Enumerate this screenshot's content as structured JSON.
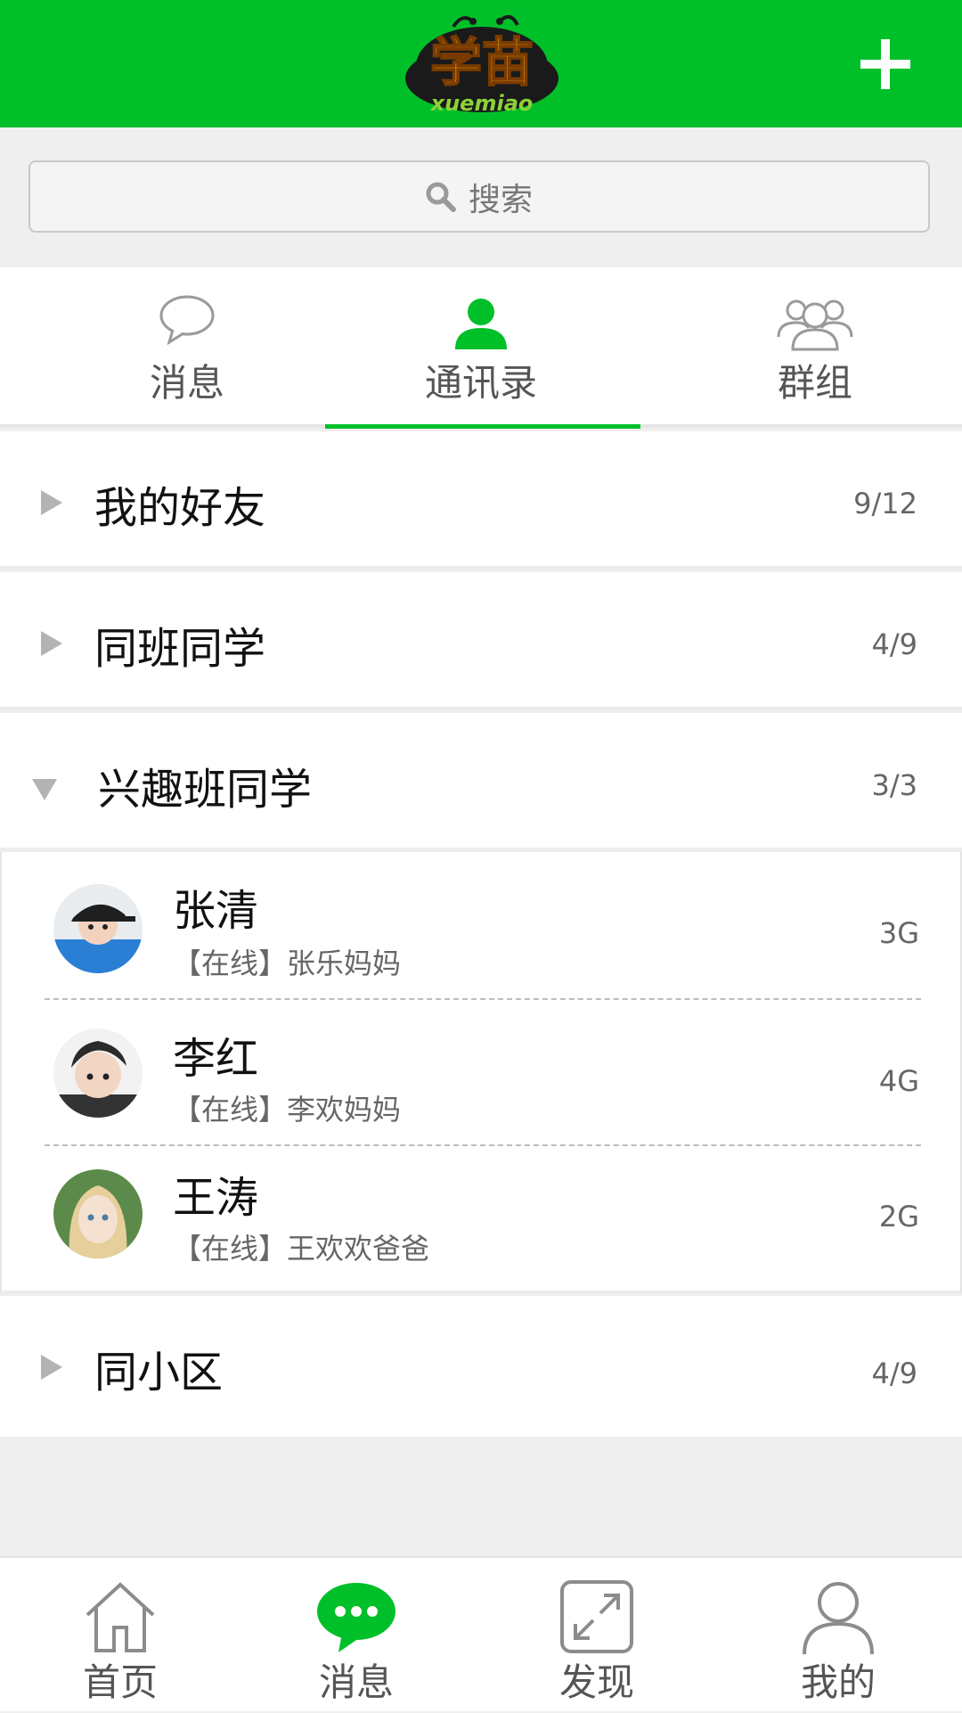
{
  "header": {
    "logo_text": "学苗",
    "logo_subtext": "xuemiao",
    "add_icon": "plus-icon",
    "brand_color": "#00c029"
  },
  "search": {
    "placeholder": "搜索",
    "icon": "search-icon"
  },
  "tabs": [
    {
      "label": "消息",
      "icon": "chat-bubble-icon",
      "active": false
    },
    {
      "label": "通讯录",
      "icon": "contact-person-icon",
      "active": true
    },
    {
      "label": "群组",
      "icon": "group-people-icon",
      "active": false
    }
  ],
  "groups": [
    {
      "name": "我的好友",
      "count": "9/12",
      "expanded": false
    },
    {
      "name": "同班同学",
      "count": "4/9",
      "expanded": false
    },
    {
      "name": "兴趣班同学",
      "count": "3/3",
      "expanded": true
    },
    {
      "name": "同小区",
      "count": "4/9",
      "expanded": false
    }
  ],
  "members": [
    {
      "name": "张清",
      "status": "【在线】张乐妈妈",
      "network": "3G"
    },
    {
      "name": "李红",
      "status": "【在线】李欢妈妈",
      "network": "4G"
    },
    {
      "name": "王涛",
      "status": "【在线】王欢欢爸爸",
      "network": "2G"
    }
  ],
  "bottom_nav": [
    {
      "label": "首页",
      "icon": "home-icon",
      "active": false
    },
    {
      "label": "消息",
      "icon": "message-dots-icon",
      "active": true
    },
    {
      "label": "发现",
      "icon": "expand-arrows-icon",
      "active": false
    },
    {
      "label": "我的",
      "icon": "user-profile-icon",
      "active": false
    }
  ]
}
